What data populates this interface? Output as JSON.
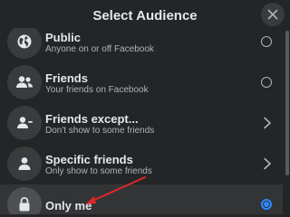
{
  "dialog": {
    "title": "Select Audience",
    "close_icon": "close-icon"
  },
  "options": [
    {
      "label": "Public",
      "subtitle": "Anyone on or off Facebook",
      "icon": "globe-icon",
      "control": "radio",
      "selected": false
    },
    {
      "label": "Friends",
      "subtitle": "Your friends on Facebook",
      "icon": "friends-icon",
      "control": "radio",
      "selected": false
    },
    {
      "label": "Friends except...",
      "subtitle": "Don't show to some friends",
      "icon": "friends-except-icon",
      "control": "chevron",
      "selected": false
    },
    {
      "label": "Specific friends",
      "subtitle": "Only show to some friends",
      "icon": "specific-friend-icon",
      "control": "chevron",
      "selected": false
    },
    {
      "label": "Only me",
      "subtitle": "",
      "icon": "lock-icon",
      "control": "radio",
      "selected": true
    }
  ],
  "colors": {
    "background": "#242526",
    "selected_row": "#323436",
    "accent": "#2d88ff",
    "annotation_arrow": "#e0272b"
  }
}
